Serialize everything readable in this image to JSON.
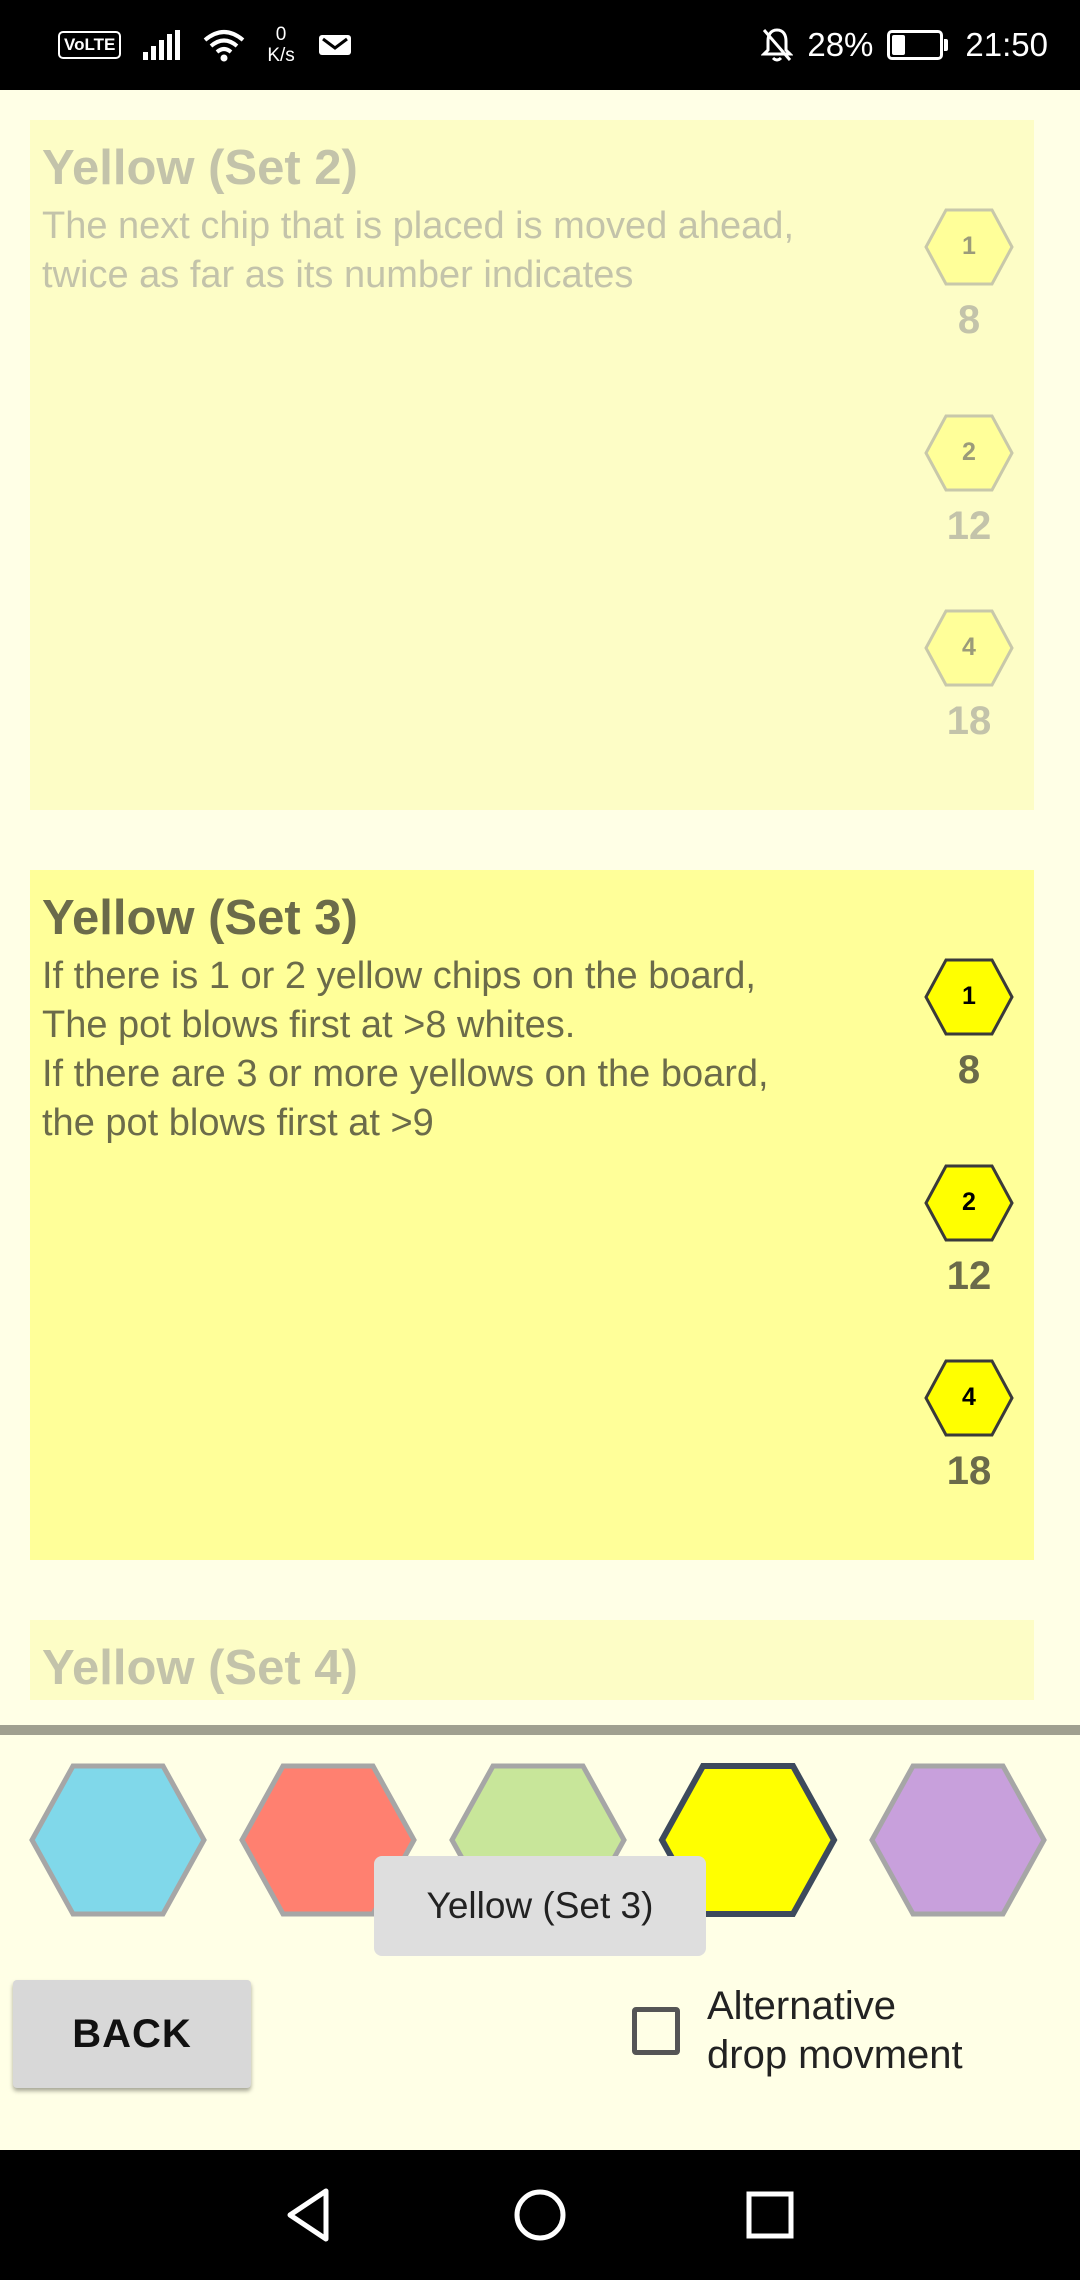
{
  "status_bar": {
    "volte": "VoLTE",
    "net_speed_value": "0",
    "net_speed_unit": "K/s",
    "battery": "28%",
    "time": "21:50"
  },
  "cards": [
    {
      "title": "Yellow (Set 2)",
      "state": "inactive",
      "description": [
        "The next chip that is placed is moved ahead,",
        "twice as far as its number indicates"
      ],
      "chips": [
        {
          "value": "1",
          "cost": "8"
        },
        {
          "value": "2",
          "cost": "12"
        },
        {
          "value": "4",
          "cost": "18"
        }
      ]
    },
    {
      "title": "Yellow (Set 3)",
      "state": "active",
      "description": [
        "If there is 1 or 2 yellow chips on the board,",
        "The pot blows first at >8 whites.",
        "If there are 3 or more yellows on the board,",
        "the pot blows first at >9"
      ],
      "chips": [
        {
          "value": "1",
          "cost": "8"
        },
        {
          "value": "2",
          "cost": "12"
        },
        {
          "value": "4",
          "cost": "18"
        }
      ]
    },
    {
      "title": "Yellow (Set 4)",
      "state": "inactive"
    }
  ],
  "color_selector": [
    {
      "name": "blue",
      "color": "#80d8ea",
      "selected": false
    },
    {
      "name": "red",
      "color": "#ff8070",
      "selected": false
    },
    {
      "name": "green",
      "color": "#c8e69a",
      "selected": false
    },
    {
      "name": "yellow",
      "color": "#ffff00",
      "selected": true
    },
    {
      "name": "purple",
      "color": "#c8a0dc",
      "selected": false
    }
  ],
  "toast": "Yellow (Set 3)",
  "back_label": "BACK",
  "alt_drop_label": [
    "Alternative",
    "drop movment"
  ],
  "alt_drop_checked": false,
  "colors": {
    "inactive_card": "#fdfdc6",
    "active_card": "#ffff99",
    "background": "#ffffe6"
  }
}
